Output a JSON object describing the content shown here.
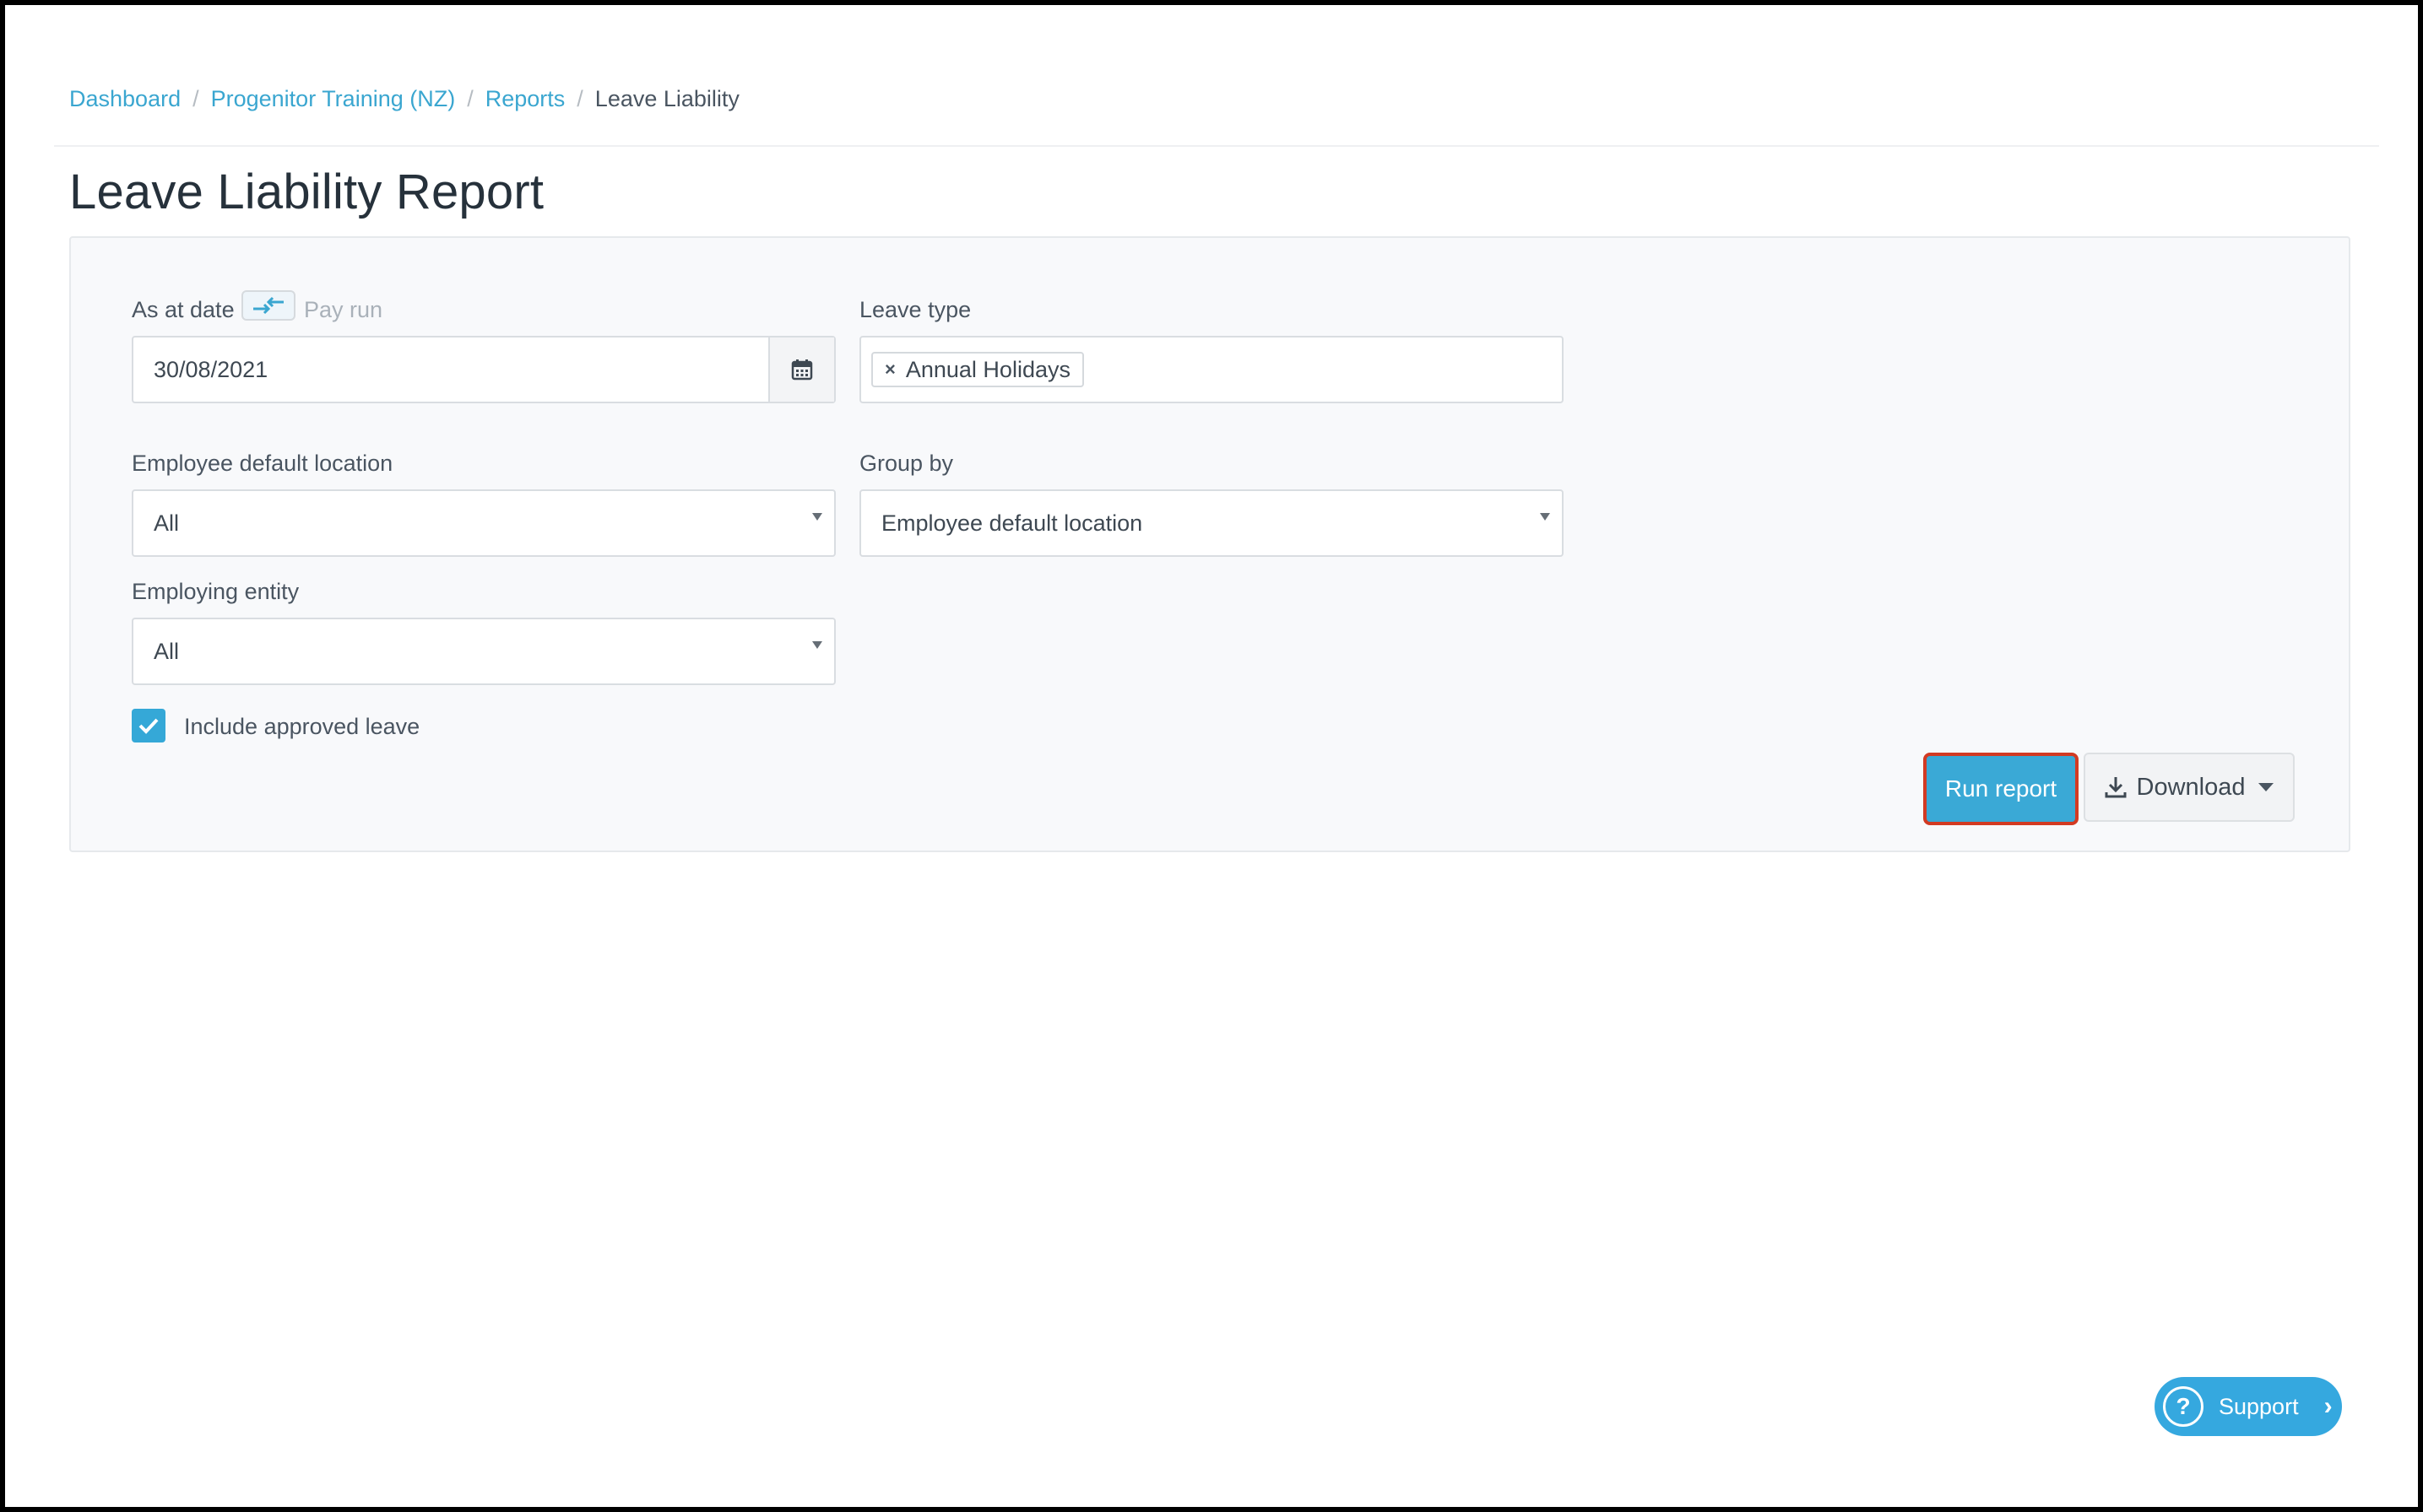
{
  "breadcrumb": {
    "items": [
      "Dashboard",
      "Progenitor Training (NZ)",
      "Reports"
    ],
    "separator": "/",
    "current": "Leave Liability"
  },
  "page": {
    "title": "Leave Liability Report"
  },
  "form": {
    "as_at_date": {
      "label": "As at date",
      "alt_label": "Pay run",
      "value": "30/08/2021",
      "toggle_icon": "swap-arrows-icon",
      "calendar_icon": "calendar-icon"
    },
    "leave_type": {
      "label": "Leave type",
      "tags": [
        "Annual Holidays"
      ]
    },
    "employee_default_location": {
      "label": "Employee default location",
      "value": "All"
    },
    "group_by": {
      "label": "Group by",
      "value": "Employee default location"
    },
    "employing_entity": {
      "label": "Employing entity",
      "value": "All"
    },
    "include_approved_leave": {
      "label": "Include approved leave",
      "checked": true
    }
  },
  "actions": {
    "run_report": "Run report",
    "download": "Download"
  },
  "support": {
    "label": "Support"
  },
  "colors": {
    "accent": "#3aa9d6",
    "highlight_border": "#d23a22",
    "link": "#3aa6d0"
  }
}
